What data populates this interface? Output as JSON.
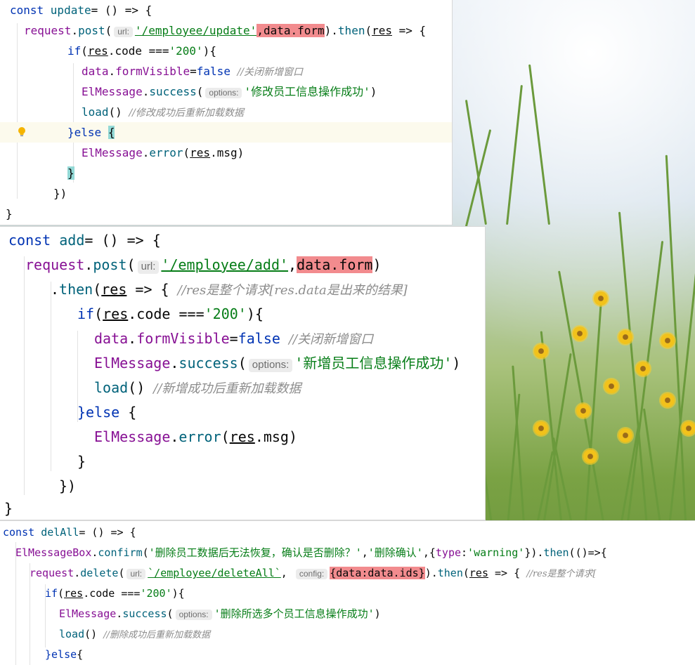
{
  "panel_update": {
    "l1": {
      "kw": "const ",
      "name": "update",
      "rest": "= () => {"
    },
    "l2": {
      "obj": "request",
      "dot": ".",
      "fn": "post",
      "open": "(",
      "hint": "url:",
      "str": "'/employee/update'",
      "comma": ",",
      "arg": "data.form",
      "close": ").",
      "then": "then",
      "paren": "(",
      "res": "res",
      "arrow": " => {"
    },
    "l3": {
      "kw": "if",
      "open": "(",
      "res": "res",
      "mid": ".code ===",
      "str": "'200'",
      "end": "){"
    },
    "l4": {
      "obj": "data",
      "dot": ".",
      "prop": "formVisible",
      "eq": "=",
      "val": "false",
      "sp": " ",
      "comment": "//关闭新增窗口"
    },
    "l5": {
      "obj": "ElMessage",
      "dot": ".",
      "fn": "success",
      "open": "(",
      "hint": "options:",
      "str": "'修改员工信息操作成功'",
      "close": ")"
    },
    "l6": {
      "fn": "load",
      "call": "() ",
      "comment": "//修改成功后重新加载数据"
    },
    "l7": {
      "brace": "}",
      "kw": "else ",
      "open": "{"
    },
    "l8": {
      "obj": "ElMessage",
      "dot": ".",
      "fn": "error",
      "open": "(",
      "res": "res",
      "tail": ".msg)"
    },
    "l9": {
      "brace": "}"
    },
    "l10": {
      "text": "})"
    },
    "l11": {
      "text": "}"
    }
  },
  "panel_add": {
    "l1": {
      "kw": "const ",
      "name": "add",
      "rest": "= () => {"
    },
    "l2": {
      "obj": "request",
      "dot": ".",
      "fn": "post",
      "open": "(",
      "hint": "url:",
      "str": "'/employee/add'",
      "comma": ",",
      "arg": "data.form",
      "close": ")"
    },
    "l3": {
      "dot": ".",
      "then": "then",
      "open": "(",
      "res": "res",
      "arrow": " => { ",
      "comment": "//res是整个请求[res.data是出来的结果]"
    },
    "l4": {
      "kw": "if",
      "open": "(",
      "res": "res",
      "mid": ".code ===",
      "str": "'200'",
      "end": "){"
    },
    "l5": {
      "obj": "data",
      "dot": ".",
      "prop": "formVisible",
      "eq": "=",
      "val": "false",
      "sp": " ",
      "comment": "//关闭新增窗口"
    },
    "l6": {
      "obj": "ElMessage",
      "dot": ".",
      "fn": "success",
      "open": "(",
      "hint": "options:",
      "str": "'新增员工信息操作成功'",
      "close": ")"
    },
    "l7": {
      "fn": "load",
      "call": "() ",
      "comment": "//新增成功后重新加载数据"
    },
    "l8": {
      "brace": "}",
      "kw": "else ",
      "open": "{"
    },
    "l9": {
      "obj": "ElMessage",
      "dot": ".",
      "fn": "error",
      "open": "(",
      "res": "res",
      "tail": ".msg)"
    },
    "l10": {
      "text": "}"
    },
    "l11": {
      "text": "})"
    },
    "l12": {
      "text": "}"
    }
  },
  "panel_delall": {
    "l1": {
      "kw": "const ",
      "name": "delAll",
      "rest": "= () => {"
    },
    "l2": {
      "obj": "ElMessageBox",
      "dot": ".",
      "fn": "confirm",
      "open": "(",
      "str1": "'删除员工数据后无法恢复，确认是否删除？'",
      "comma": ",",
      "str2": "'删除确认'",
      "comma2": ",{",
      "key": "type",
      "colon": ":",
      "str3": "'warning'",
      "close": "}).",
      "then": "then",
      "tail": "(()=>{"
    },
    "l3": {
      "obj": "request",
      "dot": ".",
      "fn": "delete",
      "open": "(",
      "hint": "url:",
      "str": "`/employee/deleteAll`",
      "comma": ", ",
      "hint2": "config:",
      "arg": "{data:data.ids}",
      "close": ").",
      "then": "then",
      "paren": "(",
      "res": "res",
      "arrow": " => { ",
      "comment": "//res是整个请求["
    },
    "l4": {
      "kw": "if",
      "open": "(",
      "res": "res",
      "mid": ".code ===",
      "str": "'200'",
      "end": "){"
    },
    "l5": {
      "obj": "ElMessage",
      "dot": ".",
      "fn": "success",
      "open": "(",
      "hint": "options:",
      "str": "'删除所选多个员工信息操作成功'",
      "close": ")"
    },
    "l6": {
      "fn": "load",
      "call": "() ",
      "comment": "//删除成功后重新加载数据"
    },
    "l7": {
      "brace": "}",
      "kw": "else",
      "open": "{"
    }
  },
  "colors": {
    "keyword": "#0033b3",
    "function": "#00627a",
    "property": "#871094",
    "string": "#067d17",
    "comment": "#8c8c8c",
    "highlight": "#f28b8e",
    "brace_match": "#93d9d6"
  }
}
